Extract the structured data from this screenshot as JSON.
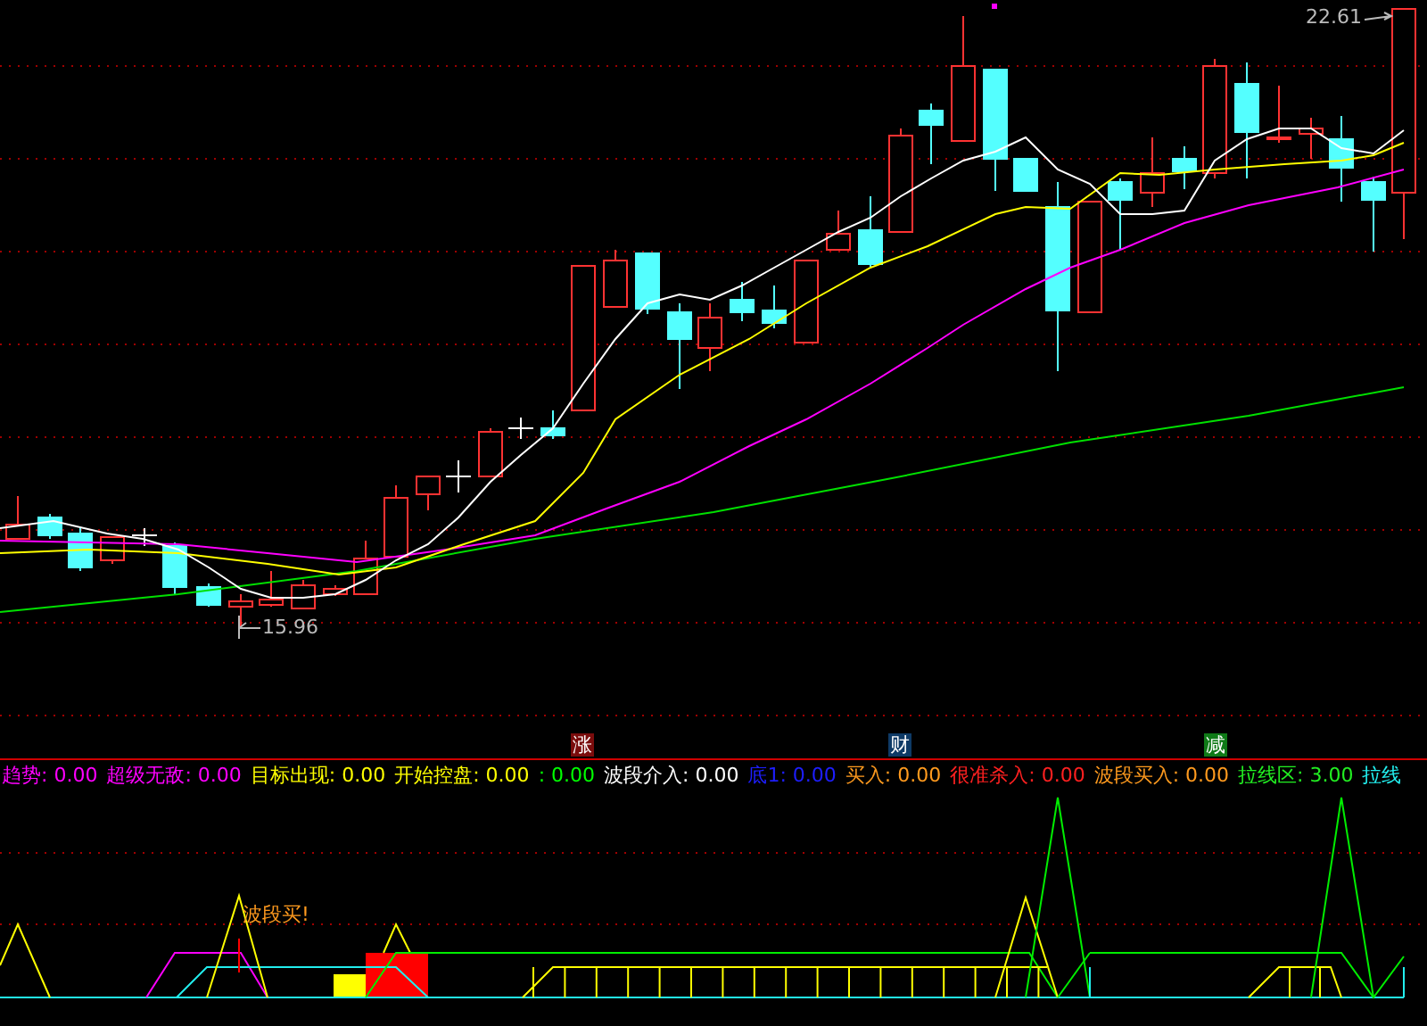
{
  "main_chart": {
    "high_label": "22.61",
    "low_label": "15.96",
    "markers": [
      {
        "text": "涨",
        "color": "#7a0c0c"
      },
      {
        "text": "财",
        "color": "#0e3a66"
      },
      {
        "text": "减",
        "color": "#0f7a17"
      }
    ]
  },
  "legend": [
    {
      "label": "趋势: 0.00",
      "color": "#ff00ff"
    },
    {
      "label": "超级无敌: 0.00",
      "color": "#ff00ff"
    },
    {
      "label": "目标出现: 0.00",
      "color": "#ffff00"
    },
    {
      "label": "开始控盘: 0.00",
      "color": "#ffff00"
    },
    {
      "label": ": 0.00",
      "color": "#00ff00"
    },
    {
      "label": "波段介入: 0.00",
      "color": "#ffffff"
    },
    {
      "label": "底1: 0.00",
      "color": "#1e1eff"
    },
    {
      "label": "买入: 0.00",
      "color": "#ff9a1e"
    },
    {
      "label": "很准杀入: 0.00",
      "color": "#ff2020"
    },
    {
      "label": "波段买入: 0.00",
      "color": "#ff9a1e"
    },
    {
      "label": "拉线区: 3.00",
      "color": "#22ee22"
    },
    {
      "label": "拉线",
      "color": "#22eeee"
    }
  ],
  "indicator": {
    "signal_label": "波段买!"
  }
}
